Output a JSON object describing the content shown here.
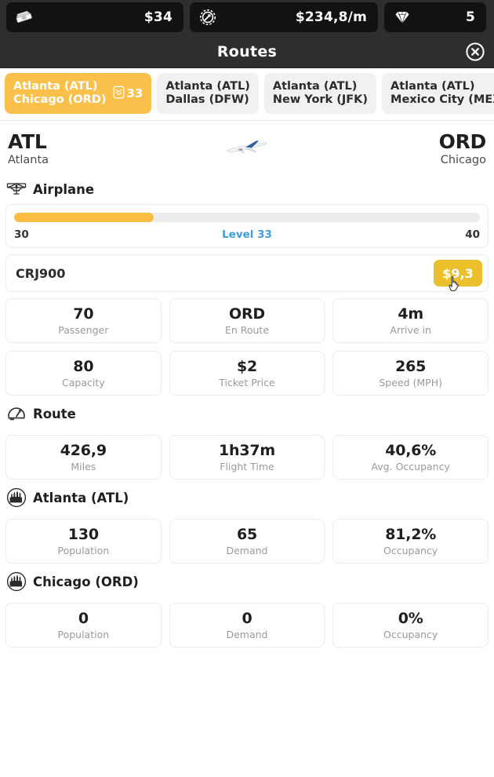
{
  "topbar": {
    "resources": [
      {
        "icon": "cash-stack-icon",
        "name": "money",
        "value": "$34"
      },
      {
        "icon": "gear-arrow-icon",
        "name": "income",
        "value": "$234,8/m"
      },
      {
        "icon": "diamond-icon",
        "name": "gems",
        "value": "5"
      }
    ]
  },
  "titlebar": {
    "title": "Routes",
    "close_icon": "close-circle-icon"
  },
  "tabs": [
    {
      "origin": "Atlanta (ATL)",
      "destination": "Chicago (ORD)",
      "badge": "33",
      "badge_icon": "rank-badge-icon",
      "active": true
    },
    {
      "origin": "Atlanta (ATL)",
      "destination": "Dallas (DFW)",
      "badge": "",
      "active": false
    },
    {
      "origin": "Atlanta (ATL)",
      "destination": "New York (JFK)",
      "badge": "",
      "active": false
    },
    {
      "origin": "Atlanta (ATL)",
      "destination": "Mexico City (MEX)",
      "badge": "",
      "active": false
    }
  ],
  "route_header": {
    "origin_code": "ATL",
    "origin_city": "Atlanta",
    "destination_code": "ORD",
    "destination_city": "Chicago",
    "plane_image": "airliner-photo"
  },
  "airplane_section": {
    "icon": "airplane-top-icon",
    "title": "Airplane",
    "level": {
      "min": "30",
      "max": "40",
      "label": "Level 33",
      "percent": 30
    },
    "plane": {
      "name": "CRJ900",
      "price": "$9,3"
    },
    "stats": [
      {
        "value": "70",
        "label": "Passenger"
      },
      {
        "value": "ORD",
        "label": "En Route"
      },
      {
        "value": "4m",
        "label": "Arrive in"
      },
      {
        "value": "80",
        "label": "Capacity"
      },
      {
        "value": "$2",
        "label": "Ticket Price"
      },
      {
        "value": "265",
        "label": "Speed (MPH)"
      }
    ]
  },
  "route_section": {
    "icon": "speedometer-icon",
    "title": "Route",
    "stats": [
      {
        "value": "426,9",
        "label": "Miles"
      },
      {
        "value": "1h37m",
        "label": "Flight Time"
      },
      {
        "value": "40,6%",
        "label": "Avg. Occupancy"
      }
    ]
  },
  "origin_section": {
    "icon": "city-skyline-icon",
    "title": "Atlanta (ATL)",
    "stats": [
      {
        "value": "130",
        "label": "Population"
      },
      {
        "value": "65",
        "label": "Demand"
      },
      {
        "value": "81,2%",
        "label": "Occupancy"
      }
    ]
  },
  "destination_section": {
    "icon": "city-skyline-icon",
    "title": "Chicago (ORD)",
    "stats": [
      {
        "value": "0",
        "label": "Population"
      },
      {
        "value": "0",
        "label": "Demand"
      },
      {
        "value": "0%",
        "label": "Occupancy"
      }
    ]
  },
  "colors": {
    "accent_yellow": "#fbc04a",
    "progress_fill": "#fbbe42",
    "price_button": "#ecc02b",
    "level_blue": "#3e9fe0",
    "topbar_bg": "#2e2e2e",
    "pill_bg": "#121212"
  }
}
